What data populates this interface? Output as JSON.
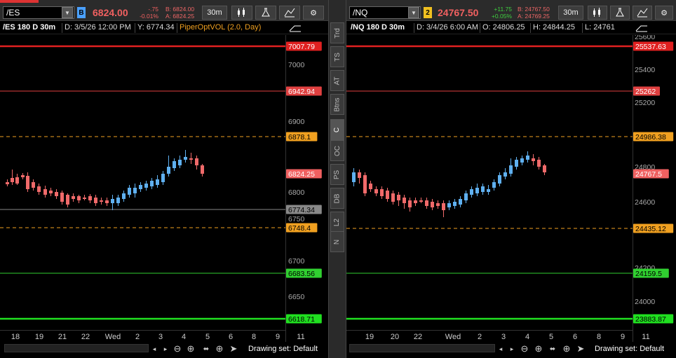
{
  "divider_tabs": [
    "Trd",
    "TS",
    "AT",
    "Btns",
    "C",
    "OC",
    "PS",
    "DB",
    "L2",
    "N"
  ],
  "left": {
    "symbol": "/ES",
    "link_badge": "B",
    "price": "6824.00",
    "change": "-.75",
    "change_pct": "-0.01%",
    "bid": "B: 6824.00",
    "ask": "A: 6824.25",
    "aggregation": "30m",
    "header": {
      "title": "/ES 180 D 30m",
      "date": "D: 3/5/26 12:00 PM",
      "y_value": "Y: 6774.34",
      "study": "PiperOptVOL (2.0, Day)"
    },
    "axis_ticks": [
      "7000",
      "6950",
      "6900",
      "6850",
      "6800",
      "6750",
      "6700",
      "6650"
    ],
    "x_labels": [
      "18",
      "19",
      "21",
      "22",
      "Wed",
      "2",
      "3",
      "4",
      "5",
      "6",
      "8",
      "9",
      "11"
    ],
    "levels": [
      {
        "label": "7007.79",
        "color": "#e02020",
        "style": "solid",
        "bold": true
      },
      {
        "label": "6942.94",
        "color": "#e04040",
        "style": "solid",
        "bold": false
      },
      {
        "label": "6878.1",
        "color": "#f0a020",
        "style": "dash",
        "bold": false
      },
      {
        "label": "6824.25",
        "color": "#f06060",
        "style": "none",
        "bold": false
      },
      {
        "label": "6774.34",
        "color": "#888888",
        "style": "solid",
        "bold": false
      },
      {
        "label": "6748.4",
        "color": "#f0a020",
        "style": "dash",
        "bold": false
      },
      {
        "label": "6683.56",
        "color": "#30d030",
        "style": "solid",
        "bold": false
      },
      {
        "label": "6618.71",
        "color": "#20e020",
        "style": "solid",
        "bold": true
      }
    ],
    "drawing_set": "Drawing set: Default"
  },
  "right": {
    "symbol": "/NQ",
    "link_badge": "2",
    "price": "24767.50",
    "change": "+11.75",
    "change_pct": "+0.05%",
    "bid": "B: 24767.50",
    "ask": "A: 24769.25",
    "aggregation": "30m",
    "header": {
      "title": "/NQ 180 D 30m",
      "date": "D: 3/4/26 6:00 AM",
      "open": "O: 24806.25",
      "high": "H: 24844.25",
      "low": "L: 24761"
    },
    "axis_ticks": [
      "25600",
      "25400",
      "25200",
      "24800",
      "24600",
      "24200",
      "24000"
    ],
    "x_labels": [
      "19",
      "20",
      "22",
      "Wed",
      "2",
      "3",
      "4",
      "5",
      "6",
      "8",
      "9",
      "11"
    ],
    "levels": [
      {
        "label": "25537.63",
        "color": "#e02020",
        "style": "solid",
        "bold": true
      },
      {
        "label": "25262",
        "color": "#e04040",
        "style": "solid",
        "bold": false
      },
      {
        "label": "24986.38",
        "color": "#f0a020",
        "style": "dash",
        "bold": false
      },
      {
        "label": "24767.5",
        "color": "#f06060",
        "style": "none",
        "bold": false
      },
      {
        "label": "24435.12",
        "color": "#f0a020",
        "style": "dash",
        "bold": false
      },
      {
        "label": "24159.5",
        "color": "#30d030",
        "style": "solid",
        "bold": false
      },
      {
        "label": "23883.87",
        "color": "#20e020",
        "style": "solid",
        "bold": true
      }
    ],
    "drawing_set": "Drawing set: Default"
  },
  "colors": {
    "up": "#5fb0f0",
    "down": "#f06a6a",
    "price_down": "#f06060",
    "price_up": "#3fd03f"
  }
}
